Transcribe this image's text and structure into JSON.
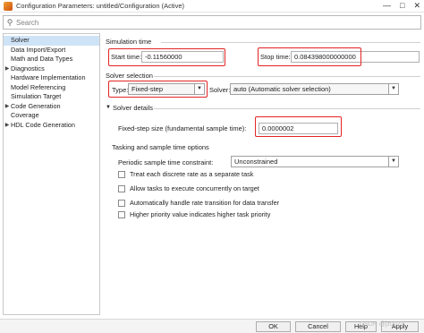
{
  "window": {
    "title": "Configuration Parameters: untitled/Configuration (Active)"
  },
  "search": {
    "placeholder": "Search"
  },
  "tree": {
    "items": [
      {
        "label": "Solver",
        "level": 0,
        "expandable": false,
        "selected": true
      },
      {
        "label": "Data Import/Export",
        "level": 0,
        "expandable": false
      },
      {
        "label": "Math and Data Types",
        "level": 0,
        "expandable": false
      },
      {
        "label": "Diagnostics",
        "level": 0,
        "expandable": true
      },
      {
        "label": "Hardware Implementation",
        "level": 0,
        "expandable": false
      },
      {
        "label": "Model Referencing",
        "level": 0,
        "expandable": false
      },
      {
        "label": "Simulation Target",
        "level": 0,
        "expandable": false
      },
      {
        "label": "Code Generation",
        "level": 0,
        "expandable": true
      },
      {
        "label": "Coverage",
        "level": 0,
        "expandable": false
      },
      {
        "label": "HDL Code Generation",
        "level": 0,
        "expandable": true
      }
    ]
  },
  "simulation_time": {
    "title": "Simulation time",
    "start_label": "Start time:",
    "start_value": "-0.11560000",
    "stop_label": "Stop time:",
    "stop_value": "0.084398000000000"
  },
  "solver_selection": {
    "title": "Solver selection",
    "type_label": "Type:",
    "type_value": "Fixed-step",
    "solver_label": "Solver:",
    "solver_value": "auto (Automatic solver selection)"
  },
  "solver_details": {
    "title": "Solver details",
    "step_label": "Fixed-step size (fundamental sample time):",
    "step_value": "0.0000002"
  },
  "tasking": {
    "title": "Tasking and sample time options",
    "periodic_label": "Periodic sample time constraint:",
    "periodic_value": "Unconstrained",
    "checkboxes": [
      {
        "label": "Treat each discrete rate as a separate task",
        "checked": false
      },
      {
        "label": "Allow tasks to execute concurrently on target",
        "checked": false
      },
      {
        "label": "Automatically handle rate transition for data transfer",
        "checked": false
      },
      {
        "label": "Higher priority value indicates higher task priority",
        "checked": false
      }
    ]
  },
  "buttons": {
    "ok": "OK",
    "cancel": "Cancel",
    "help": "Help",
    "apply": "Apply"
  },
  "watermark": "CSDN @jz0023",
  "colors": {
    "highlight": "#e32424",
    "selection": "#cfe3f7"
  }
}
